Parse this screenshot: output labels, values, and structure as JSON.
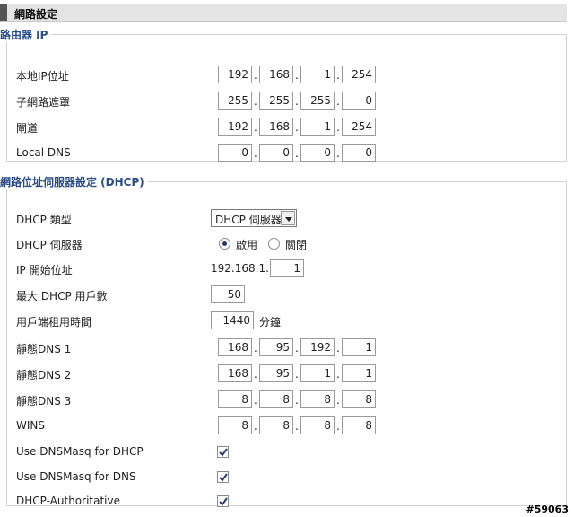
{
  "page": {
    "title": "網路設定"
  },
  "router_ip": {
    "legend": "路由器 IP",
    "local_ip": {
      "label": "本地IP位址",
      "octets": [
        "192",
        "168",
        "1",
        "254"
      ]
    },
    "subnet_mask": {
      "label": "子網路遮罩",
      "octets": [
        "255",
        "255",
        "255",
        "0"
      ]
    },
    "gateway": {
      "label": "閘道",
      "octets": [
        "192",
        "168",
        "1",
        "254"
      ]
    },
    "local_dns": {
      "label": "Local DNS",
      "octets": [
        "0",
        "0",
        "0",
        "0"
      ]
    }
  },
  "dhcp": {
    "legend": "網路位址伺服器設定 (DHCP)",
    "type": {
      "label": "DHCP 類型",
      "selected": "DHCP 伺服器"
    },
    "server": {
      "label": "DHCP 伺服器",
      "enable_label": "啟用",
      "disable_label": "關閉",
      "enabled": true
    },
    "start_ip": {
      "label": "IP 開始位址",
      "prefix": "192.168.1.",
      "value": "1"
    },
    "max_users": {
      "label": "最大 DHCP 用戶數",
      "value": "50"
    },
    "lease_time": {
      "label": "用戶端租用時間",
      "value": "1440",
      "unit": "分鐘"
    },
    "static_dns1": {
      "label": "靜態DNS 1",
      "octets": [
        "168",
        "95",
        "192",
        "1"
      ]
    },
    "static_dns2": {
      "label": "靜態DNS 2",
      "octets": [
        "168",
        "95",
        "1",
        "1"
      ]
    },
    "static_dns3": {
      "label": "靜態DNS 3",
      "octets": [
        "8",
        "8",
        "8",
        "8"
      ]
    },
    "wins": {
      "label": "WINS",
      "octets": [
        "8",
        "8",
        "8",
        "8"
      ]
    },
    "dnsmasq_dhcp": {
      "label": "Use DNSMasq for DHCP",
      "checked": true
    },
    "dnsmasq_dns": {
      "label": "Use DNSMasq for DNS",
      "checked": true
    },
    "authoritative": {
      "label": "DHCP-Authoritative",
      "checked": true
    }
  },
  "watermark": "#59063"
}
